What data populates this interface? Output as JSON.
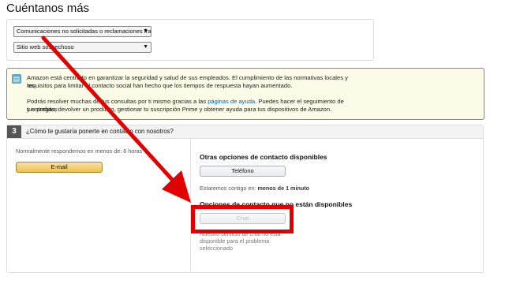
{
  "page": {
    "title": "Cuéntanos más"
  },
  "selects": [
    {
      "value": "Comunicaciones no solicitadas o reclamaciones fra"
    },
    {
      "value": "Sitio web sospechoso"
    }
  ],
  "info": {
    "line1": "Amazon está centrado en garantizar la seguridad y salud de sus empleados. El cumplimiento de las normativas locales y los",
    "line2": "requisitos para limitar el contacto social han hecho que los tiempos de respuesta hayan aumentado.",
    "line3_pre": "Podrás resolver muchas de tus consultas por ti mismo gracias a las ",
    "line3_link": "páginas de ayuda",
    "line3_post": ". Puedes hacer el seguimiento de tus pedidos",
    "line4": "y entregas, devolver un producto, gestionar tu suscripción Prime y obtener ayuda para tus dispositivos de Amazon."
  },
  "section": {
    "number": "3",
    "question": "¿Cómo te gustaría ponerte en contacto con nosotros?",
    "email_note": "Normalmente respondemos en menos de: 6 horas",
    "email_button": "E-mail",
    "other_heading": "Otras opciones de contacto disponibles",
    "phone_button": "Teléfono",
    "phone_note_pre": "Estaremos contigo en: ",
    "phone_note_bold": "menos de 1 minuto",
    "unavailable_heading": "Opciones de contacto que no están disponibles",
    "chat_button": "Chat",
    "chat_note_1": "Nuestro servicio de chat no está",
    "chat_note_2": "disponible para el problema",
    "chat_note_3": "seleccionado"
  },
  "annotation": {
    "arrow_color": "#e00000"
  }
}
